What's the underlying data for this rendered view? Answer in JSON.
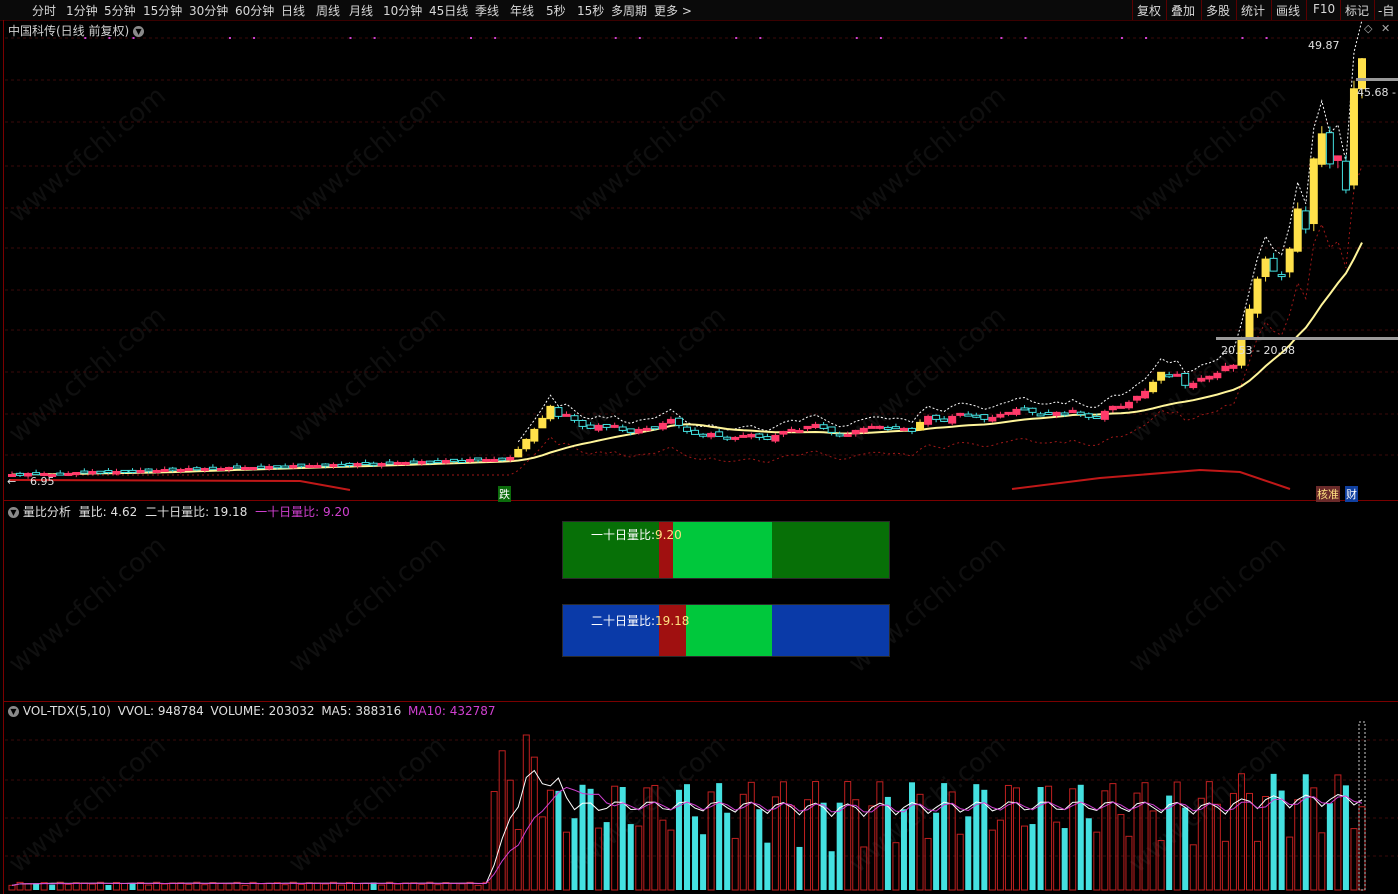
{
  "toolbar": {
    "periods": [
      "分时",
      "1分钟",
      "5分钟",
      "15分钟",
      "30分钟",
      "60分钟",
      "日线",
      "周线",
      "月线",
      "10分钟",
      "45日线",
      "季线",
      "年线",
      "5秒",
      "15秒",
      "多周期",
      "更多 >"
    ],
    "right": [
      "复权",
      "叠加",
      "多股",
      "统计",
      "画线",
      "F10",
      "标记",
      "-自"
    ]
  },
  "main_chart": {
    "title": "中国科传(日线 前复权)",
    "high_label": "49.87",
    "price_label_right": "45.68 -",
    "range_label": "20.53 - 20.98",
    "low_label": "6.95",
    "tag_fall": "跌",
    "tag_right1": "核准",
    "tag_right2": "财"
  },
  "ratio_panel": {
    "title": "量比分析",
    "liangbi_label": "量比:",
    "liangbi_value": "4.62",
    "ershi_label": "二十日量比:",
    "ershi_value": "19.18",
    "yishi_label": "一十日量比:",
    "yishi_value": "9.20",
    "box1_label": "一十日量比:",
    "box1_value": "9.20",
    "box2_label": "二十日量比:",
    "box2_value": "19.18"
  },
  "vol_panel": {
    "name": "VOL-TDX(5,10)",
    "vvol_label": "VVOL:",
    "vvol_value": "948784",
    "volume_label": "VOLUME:",
    "volume_value": "203032",
    "ma5_label": "MA5:",
    "ma5_value": "388316",
    "ma10_label": "MA10:",
    "ma10_value": "432787"
  },
  "watermark": "www.cfchi.com",
  "colors": {
    "up": "#ff3a6a",
    "down": "#44e0e0",
    "yellow": "#ffe14a",
    "ma_line": "#fff59a",
    "ma10": "#d040d0",
    "green_box": "#087008",
    "green_bright": "#00c83c",
    "blue_box": "#0a3aa8",
    "red_bar": "#a01010"
  },
  "chart_data": {
    "type": "candlestick",
    "price_range": [
      6.95,
      49.87
    ],
    "closes": [
      7.0,
      7.0,
      7.1,
      7.0,
      7.1,
      7.0,
      7.1,
      7.1,
      7.2,
      7.2,
      7.3,
      7.3,
      7.2,
      7.3,
      7.4,
      7.3,
      7.4,
      7.4,
      7.4,
      7.5,
      7.5,
      7.5,
      7.6,
      7.6,
      7.6,
      7.6,
      7.6,
      7.7,
      7.7,
      7.7,
      7.7,
      7.7,
      7.8,
      7.8,
      7.8,
      7.9,
      7.9,
      7.9,
      7.9,
      7.9,
      8.0,
      8.0,
      8.0,
      8.1,
      8.1,
      8.0,
      8.1,
      8.2,
      8.2,
      8.2,
      8.2,
      8.3,
      8.3,
      8.3,
      8.4,
      8.4,
      8.4,
      8.5,
      8.5,
      8.5,
      8.5,
      8.6,
      8.7,
      9.5,
      10.5,
      11.5,
      12.6,
      13.8,
      12.8,
      13.0,
      12.4,
      11.8,
      11.6,
      11.9,
      11.7,
      11.9,
      11.4,
      11.2,
      11.5,
      11.6,
      11.7,
      12.1,
      12.5,
      11.9,
      11.3,
      11.0,
      10.9,
      11.1,
      10.8,
      10.6,
      10.7,
      10.9,
      11.0,
      10.7,
      10.5,
      10.9,
      11.3,
      11.5,
      11.4,
      11.8,
      12.0,
      11.6,
      11.2,
      10.9,
      11.0,
      11.4,
      11.6,
      11.8,
      11.8,
      11.6,
      11.7,
      11.6,
      11.3,
      12.2,
      12.8,
      12.5,
      12.3,
      12.8,
      13.1,
      13.0,
      12.8,
      12.5,
      12.7,
      13.0,
      13.2,
      13.5,
      13.6,
      13.2,
      13.0,
      13.0,
      13.2,
      13.0,
      13.4,
      13.0,
      12.7,
      12.7,
      13.3,
      13.8,
      13.8,
      14.2,
      14.8,
      15.3,
      16.2,
      17.2,
      16.8,
      17.0,
      15.9,
      16.1,
      16.6,
      16.8,
      17.1,
      17.8,
      17.9,
      20.5,
      23.5,
      26.5,
      28.5,
      27.3,
      26.8,
      29.5,
      33.5,
      31.5,
      38.5,
      41.0,
      38.0,
      38.8,
      35.4,
      45.5,
      48.5
    ]
  }
}
